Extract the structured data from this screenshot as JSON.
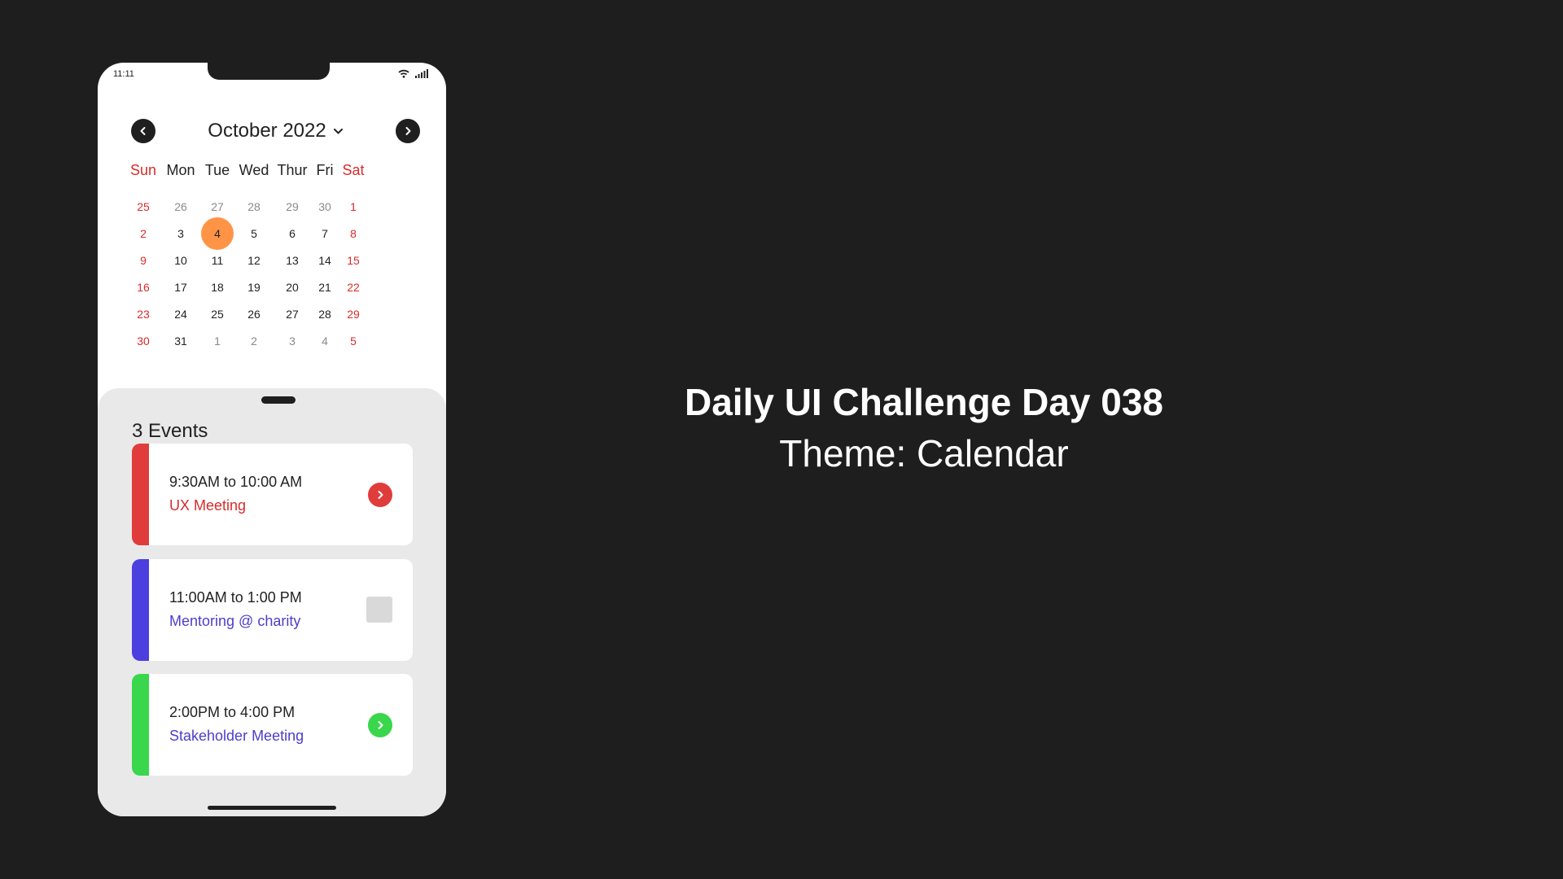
{
  "status_bar": {
    "time": "11:11",
    "wifi_icon": "wifi-icon",
    "signal_icon": "signal-icon"
  },
  "calendar": {
    "month_label": "October 2022",
    "prev_icon": "chevron-left-icon",
    "next_icon": "chevron-right-icon",
    "dropdown_icon": "chevron-down-icon",
    "weekdays": [
      "Sun",
      "Mon",
      "Tue",
      "Wed",
      "Thur",
      "Fri",
      "Sat"
    ],
    "weeks": [
      [
        "25",
        "26",
        "27",
        "28",
        "29",
        "30",
        "1"
      ],
      [
        "2",
        "3",
        "4",
        "5",
        "6",
        "7",
        "8"
      ],
      [
        "9",
        "10",
        "11",
        "12",
        "13",
        "14",
        "15"
      ],
      [
        "16",
        "17",
        "18",
        "19",
        "20",
        "21",
        "22"
      ],
      [
        "23",
        "24",
        "25",
        "26",
        "27",
        "28",
        "29"
      ],
      [
        "30",
        "31",
        "1",
        "2",
        "3",
        "4",
        "5"
      ]
    ],
    "selected_day": "4",
    "weekend_color": "#d92b2b",
    "selected_color": "#ff9447"
  },
  "events": {
    "count_label": "3 Events",
    "items": [
      {
        "time": "9:30AM to 10:00 AM",
        "name": "UX Meeting",
        "color": "#e03c3c",
        "name_color": "#d92b2b",
        "action": "chevron-right-icon"
      },
      {
        "time": "11:00AM to 1:00 PM",
        "name": "Mentoring @ charity",
        "color": "#4b3fe0",
        "name_color": "#4b3fc9",
        "action": "checkbox"
      },
      {
        "time": "2:00PM to 4:00 PM",
        "name": "Stakeholder Meeting",
        "color": "#3ad64b",
        "name_color": "#4b3fc9",
        "action": "chevron-right-icon"
      }
    ]
  },
  "headline": {
    "title": "Daily UI Challenge Day 038",
    "subtitle": "Theme: Calendar"
  }
}
